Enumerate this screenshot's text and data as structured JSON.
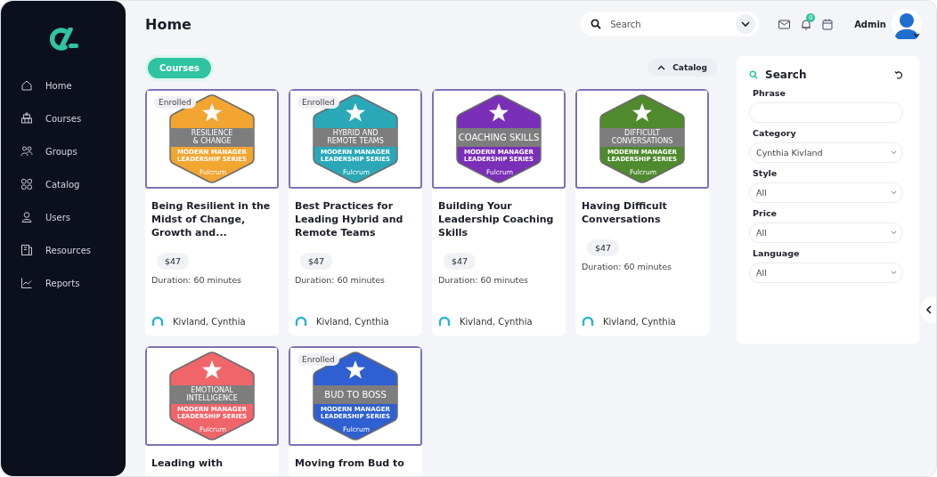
{
  "sidebar": {
    "items": [
      {
        "label": "Home"
      },
      {
        "label": "Courses"
      },
      {
        "label": "Groups"
      },
      {
        "label": "Catalog"
      },
      {
        "label": "Users"
      },
      {
        "label": "Resources"
      },
      {
        "label": "Reports"
      }
    ]
  },
  "header": {
    "title": "Home",
    "search": {
      "placeholder": "Search"
    },
    "notification_count": "0",
    "user": "Admin"
  },
  "tabs": [
    {
      "label": "Courses",
      "selected": true
    }
  ],
  "catalog_toggle": {
    "label": "Catalog",
    "expanded": true
  },
  "courses": [
    {
      "enrolled_tag": "Enrolled",
      "color": "#f2a531",
      "badge_title": [
        "RESILIENCE",
        "& CHANGE"
      ],
      "badge_series": [
        "MODERN MANAGER",
        "LEADERSHIP SERIES"
      ],
      "badge_brand": "Fulcrum",
      "title": "Being Resilient in the Midst of Change, Growth and...",
      "price": "$47",
      "duration": "Duration: 60 minutes",
      "instructor": "Kivland, Cynthia"
    },
    {
      "enrolled_tag": "Enrolled",
      "color": "#2aa8b8",
      "badge_title": [
        "HYBRID AND",
        "REMOTE TEAMS"
      ],
      "badge_series": [
        "MODERN MANAGER",
        "LEADERSHIP SERIES"
      ],
      "badge_brand": "Fulcrum",
      "title": "Best Practices for Leading Hybrid and Remote Teams",
      "price": "$47",
      "duration": "Duration: 60 minutes",
      "instructor": "Kivland, Cynthia"
    },
    {
      "color": "#7a2fb8",
      "badge_title": [
        "COACHING SKILLS"
      ],
      "badge_series": [
        "MODERN MANAGER",
        "LEADERSHIP SERIES"
      ],
      "badge_brand": "Fulcrum",
      "title": "Building Your Leadership Coaching Skills",
      "price": "$47",
      "duration": "Duration: 60 minutes",
      "instructor": "Kivland, Cynthia"
    },
    {
      "color": "#4f8a2e",
      "badge_title": [
        "DIFFICULT",
        "CONVERSATIONS"
      ],
      "badge_series": [
        "MODERN MANAGER",
        "LEADERSHIP SERIES"
      ],
      "badge_brand": "Fulcrum",
      "title": "Having Difficult Conversations",
      "price": "$47",
      "duration": "Duration: 60 minutes",
      "instructor": "Kivland, Cynthia"
    },
    {
      "color": "#f0656a",
      "badge_title": [
        "EMOTIONAL",
        "INTELLIGENCE"
      ],
      "badge_series": [
        "MODERN MANAGER",
        "LEADERSHIP SERIES"
      ],
      "badge_brand": "Fulcrum",
      "title": "Leading with"
    },
    {
      "enrolled_tag": "Enrolled",
      "color": "#2f5fd0",
      "badge_title": [
        "BUD TO BOSS"
      ],
      "badge_series": [
        "MODERN MANAGER",
        "LEADERSHIP SERIES"
      ],
      "badge_brand": "Fulcrum",
      "title": "Moving from Bud to"
    }
  ],
  "filter": {
    "title": "Search",
    "fields": [
      {
        "label": "Phrase",
        "kind": "text"
      },
      {
        "label": "Category",
        "kind": "select",
        "value": "Cynthia Kivland"
      },
      {
        "label": "Style",
        "kind": "select",
        "value": "All"
      },
      {
        "label": "Price",
        "kind": "select",
        "value": "All"
      },
      {
        "label": "Language",
        "kind": "select",
        "value": "All"
      }
    ]
  }
}
